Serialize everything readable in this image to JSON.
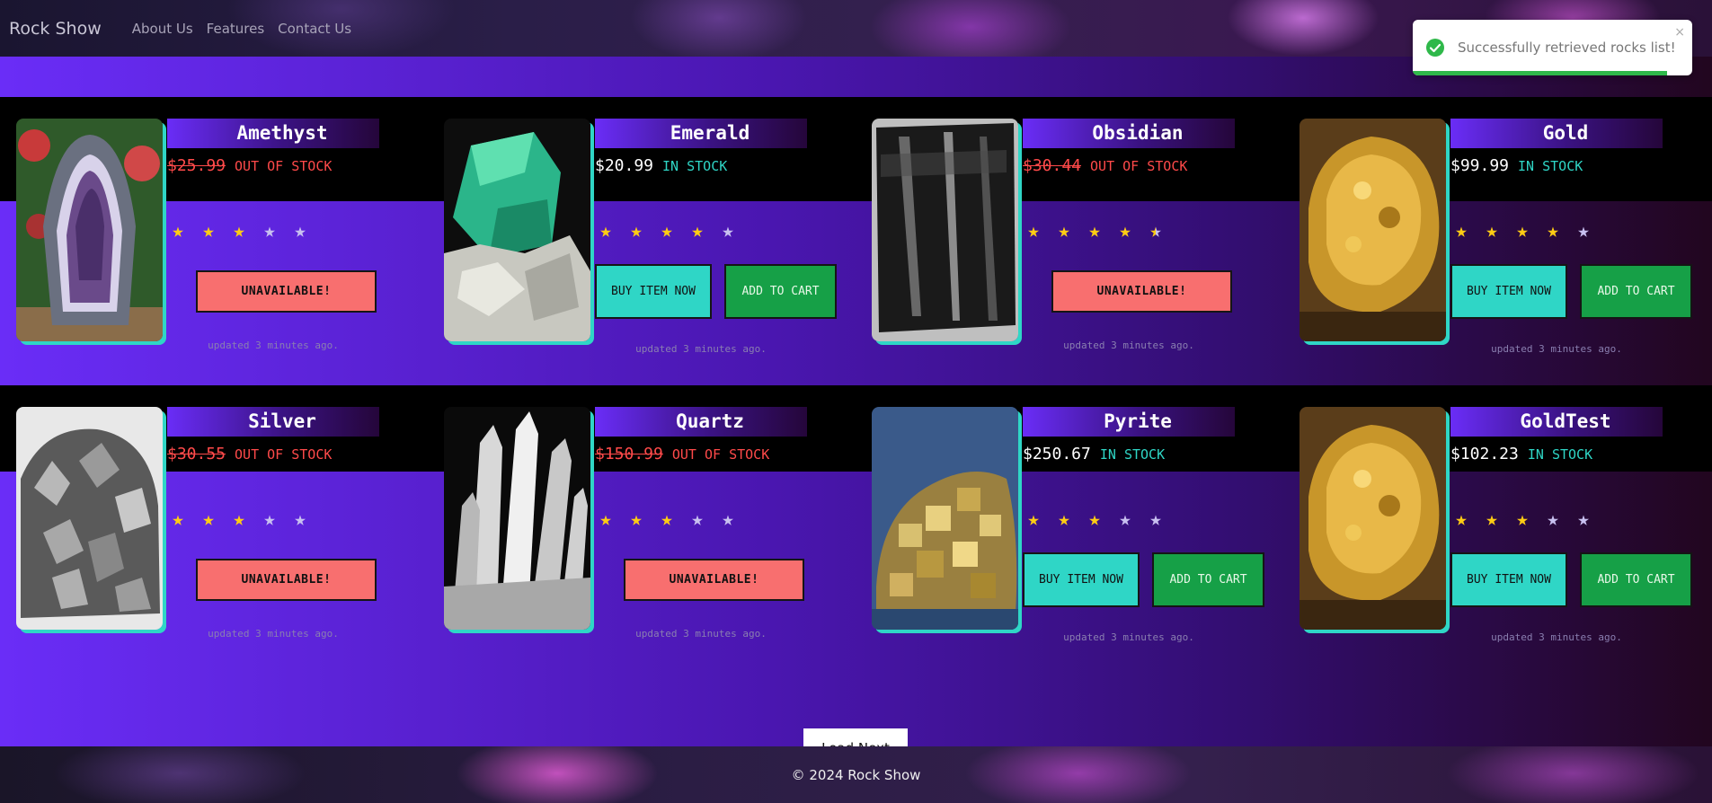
{
  "nav": {
    "brand": "Rock Show",
    "links": [
      "About Us",
      "Features",
      "Contact Us"
    ]
  },
  "toast": {
    "message": "Successfully retrieved rocks list!",
    "close": "×",
    "progress": 0.91,
    "color": "#2fb84a"
  },
  "products": [
    {
      "name": "Amethyst",
      "price": "$25.99",
      "stock": "OUT OF STOCK",
      "in_stock": false,
      "rating": 3,
      "action": "UNAVAILABLE!",
      "updated": "updated 3 minutes ago."
    },
    {
      "name": "Emerald",
      "price": "$20.99",
      "stock": "IN STOCK",
      "in_stock": true,
      "rating": 4,
      "buy": "BUY ITEM NOW",
      "cart": "ADD TO CART",
      "updated": "updated 3 minutes ago."
    },
    {
      "name": "Obsidian",
      "price": "$30.44",
      "stock": "OUT OF STOCK",
      "in_stock": false,
      "rating": 4.5,
      "action": "UNAVAILABLE!",
      "updated": "updated 3 minutes ago."
    },
    {
      "name": "Gold",
      "price": "$99.99",
      "stock": "IN STOCK",
      "in_stock": true,
      "rating": 4,
      "buy": "BUY ITEM NOW",
      "cart": "ADD TO CART",
      "updated": "updated 3 minutes ago."
    },
    {
      "name": "Silver",
      "price": "$30.55",
      "stock": "OUT OF STOCK",
      "in_stock": false,
      "rating": 3,
      "action": "UNAVAILABLE!",
      "updated": "updated 3 minutes ago."
    },
    {
      "name": "Quartz",
      "price": "$150.99",
      "stock": "OUT OF STOCK",
      "in_stock": false,
      "rating": 3,
      "action": "UNAVAILABLE!",
      "updated": "updated 3 minutes ago."
    },
    {
      "name": "Pyrite",
      "price": "$250.67",
      "stock": "IN STOCK",
      "in_stock": true,
      "rating": 3,
      "buy": "BUY ITEM NOW",
      "cart": "ADD TO CART",
      "updated": "updated 3 minutes ago."
    },
    {
      "name": "GoldTest",
      "price": "$102.23",
      "stock": "IN STOCK",
      "in_stock": true,
      "rating": 3,
      "buy": "BUY ITEM NOW",
      "cart": "ADD TO CART",
      "updated": "updated 3 minutes ago."
    }
  ],
  "load_next": "Load Next",
  "footer": "© 2024 Rock Show",
  "colors": {
    "accent_teal": "#2fd6c6",
    "cart_green": "#16a047",
    "unavailable_red": "#f86f6f",
    "out_of_stock": "#ff4a4a",
    "star_on": "#ffcc14",
    "star_off": "#c8c0f0"
  }
}
